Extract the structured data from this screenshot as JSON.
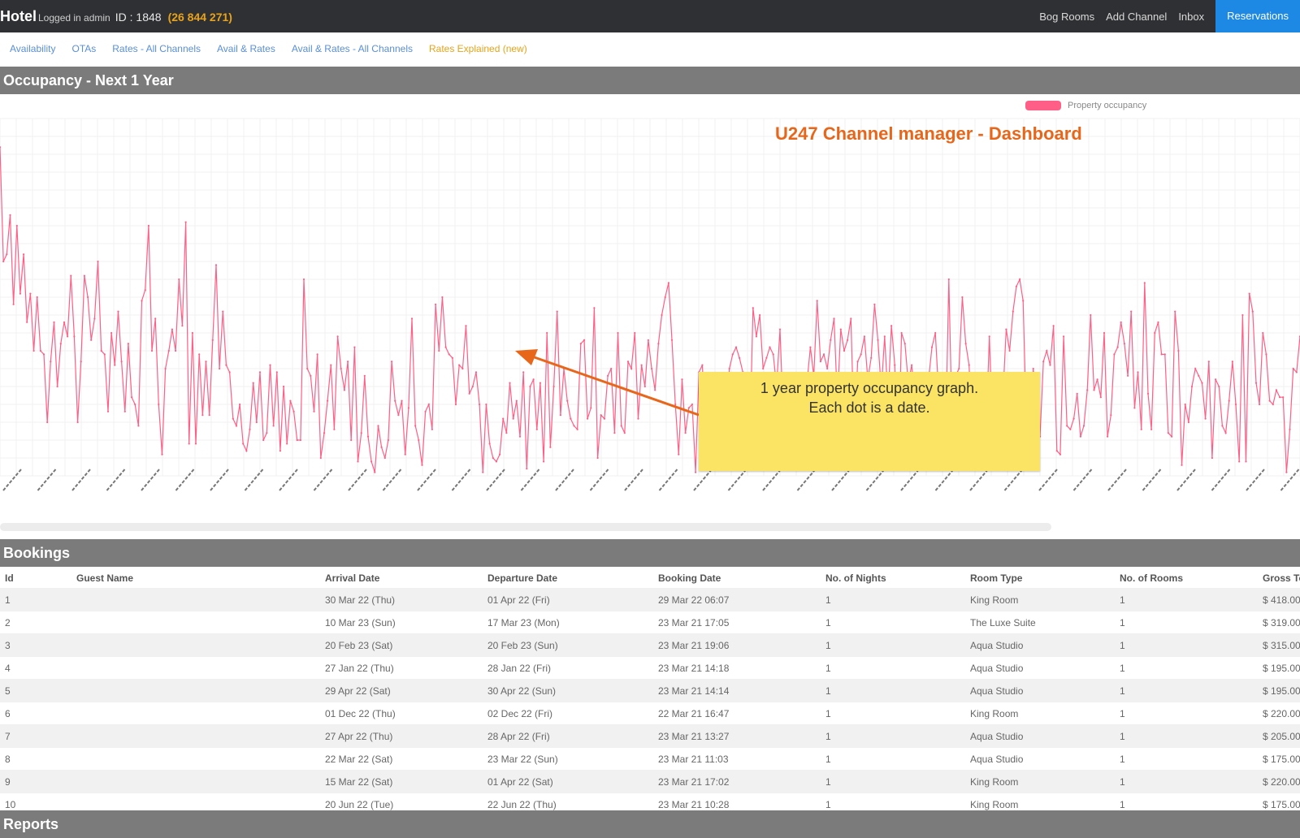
{
  "topbar": {
    "brand": "Hotel",
    "logged_in": "Logged in admin",
    "property_id": "ID : 1848",
    "phone": "(26 844 271)",
    "links": [
      "Bog Rooms",
      "Add Channel",
      "Inbox"
    ],
    "book_button": "Reservations"
  },
  "subnav": {
    "links": [
      "Availability",
      "OTAs",
      "Rates - All Channels",
      "Avail & Rates",
      "Avail & Rates - All Channels",
      "Rates Explained (new)"
    ]
  },
  "occupancy": {
    "header": "Occupancy - Next 1 Year",
    "legend": "Property occupancy",
    "overlay_title": "U247 Channel manager - Dashboard",
    "note_line1": "1 year property occupancy graph.",
    "note_line2": "Each dot is a date."
  },
  "colors": {
    "series": "#ff5f86",
    "annotation": "#e8661a",
    "note_bg": "#fbe463",
    "section_bg": "#7b7b7b",
    "topbar_bg": "#2f3033"
  },
  "chart_data": {
    "type": "line",
    "series": [
      {
        "name": "Property occupancy",
        "values": [
          92,
          60,
          62,
          73,
          48,
          70,
          51,
          62,
          43,
          51,
          35,
          50,
          35,
          34,
          15,
          32,
          43,
          25,
          37,
          43,
          39,
          56,
          39,
          15,
          32,
          56,
          50,
          38,
          44,
          60,
          35,
          34,
          18,
          40,
          31,
          46,
          32,
          18,
          37,
          22,
          20,
          14,
          49,
          52,
          70,
          35,
          44,
          20,
          6,
          30,
          35,
          41,
          35,
          55,
          42,
          71,
          9,
          40,
          9,
          34,
          17,
          32,
          17,
          38,
          59,
          30,
          46,
          31,
          29,
          16,
          14,
          20,
          9,
          7,
          13,
          26,
          15,
          29,
          10,
          12,
          31,
          14,
          29,
          7,
          25,
          9,
          21,
          18,
          10,
          10,
          55,
          30,
          28,
          18,
          34,
          5,
          12,
          21,
          31,
          13,
          39,
          30,
          24,
          32,
          10,
          36,
          4,
          12,
          28,
          11,
          4,
          1,
          14,
          8,
          5,
          10,
          32,
          21,
          17,
          21,
          6,
          19,
          44,
          14,
          10,
          3,
          18,
          20,
          13,
          48,
          35,
          50,
          36,
          34,
          33,
          20,
          31,
          30,
          42,
          23,
          25,
          29,
          20,
          1,
          20,
          9,
          5,
          4,
          6,
          16,
          12,
          26,
          16,
          21,
          11,
          29,
          2,
          25,
          27,
          13,
          26,
          4,
          40,
          8,
          25,
          46,
          17,
          30,
          21,
          16,
          14,
          13,
          37,
          38,
          16,
          19,
          47,
          5,
          17,
          16,
          28,
          30,
          12,
          40,
          14,
          12,
          32,
          30,
          40,
          16,
          31,
          25,
          38,
          30,
          24,
          37,
          45,
          50,
          54,
          38,
          20,
          6,
          27,
          12,
          19,
          20,
          1,
          29,
          31,
          13,
          19,
          21,
          12,
          5,
          3,
          11,
          30,
          34,
          36,
          33,
          29,
          16,
          7,
          47,
          39,
          45,
          30,
          33,
          36,
          34,
          25,
          41,
          15,
          14,
          12,
          23,
          19,
          23,
          10,
          26,
          36,
          28,
          49,
          32,
          34,
          30,
          38,
          44,
          21,
          41,
          35,
          38,
          44,
          10,
          32,
          34,
          39,
          27,
          33,
          48,
          38,
          24,
          39,
          21,
          42,
          31,
          4,
          40,
          37,
          26,
          31,
          21,
          17,
          8,
          16,
          27,
          36,
          40,
          23,
          23,
          8,
          55,
          13,
          28,
          30,
          50,
          37,
          31,
          10,
          11,
          21,
          27,
          12,
          39,
          10,
          7,
          21,
          22,
          41,
          35,
          46,
          53,
          55,
          49,
          13,
          15,
          30,
          18,
          11,
          32,
          35,
          31,
          42,
          7,
          6,
          39,
          14,
          13,
          16,
          23,
          11,
          14,
          24,
          45,
          24,
          27,
          22,
          40,
          11,
          17,
          34,
          36,
          43,
          37,
          28,
          46,
          19,
          29,
          13,
          54,
          23,
          13,
          40,
          43,
          34,
          34,
          12,
          11,
          46,
          35,
          3,
          20,
          15,
          25,
          30,
          28,
          26,
          16,
          32,
          5,
          27,
          25,
          14,
          12,
          21,
          32,
          20,
          4,
          45,
          4,
          51,
          46,
          26,
          20,
          40,
          34,
          21,
          20,
          24,
          22,
          22,
          1,
          13,
          30,
          29,
          39
        ]
      }
    ],
    "ylim": [
      0,
      100
    ],
    "grid": true,
    "legend_position": "top-right"
  },
  "bookings": {
    "header": "Bookings",
    "columns": [
      "Id",
      "Guest Name",
      "Arrival Date",
      "Departure Date",
      "Booking Date",
      "No. of Nights",
      "Room Type",
      "No. of Rooms",
      "Gross Total"
    ],
    "rows": [
      [
        "1",
        "",
        "30 Mar 22 (Thu)",
        "01 Apr 22 (Fri)",
        "29 Mar 22 06:07",
        "1",
        "King Room",
        "1",
        "$ 418.00"
      ],
      [
        "2",
        "",
        "10 Mar 23 (Sun)",
        "17 Mar 23 (Mon)",
        "23 Mar 21 17:05",
        "1",
        "The Luxe Suite",
        "1",
        "$ 319.00"
      ],
      [
        "3",
        "",
        "20 Feb 23 (Sat)",
        "20 Feb 23 (Sun)",
        "23 Mar 21 19:06",
        "1",
        "Aqua Studio",
        "1",
        "$ 315.00"
      ],
      [
        "4",
        "",
        "27 Jan 22 (Thu)",
        "28 Jan 22 (Fri)",
        "23 Mar 21 14:18",
        "1",
        "Aqua Studio",
        "1",
        "$ 195.00"
      ],
      [
        "5",
        "",
        "29 Apr 22 (Sat)",
        "30 Apr 22 (Sun)",
        "23 Mar 21 14:14",
        "1",
        "Aqua Studio",
        "1",
        "$ 195.00"
      ],
      [
        "6",
        "",
        "01 Dec 22 (Thu)",
        "02 Dec 22 (Fri)",
        "22 Mar 21 16:47",
        "1",
        "King Room",
        "1",
        "$ 220.00"
      ],
      [
        "7",
        "",
        "27 Apr 22 (Thu)",
        "28 Apr 22 (Fri)",
        "23 Mar 21 13:27",
        "1",
        "Aqua Studio",
        "1",
        "$ 205.00"
      ],
      [
        "8",
        "",
        "22 Mar 22 (Sat)",
        "23 Mar 22 (Sun)",
        "23 Mar 21 11:03",
        "1",
        "Aqua Studio",
        "1",
        "$ 175.00"
      ],
      [
        "9",
        "",
        "15 Mar 22 (Sat)",
        "01 Apr 22 (Sat)",
        "23 Mar 21 17:02",
        "1",
        "King Room",
        "1",
        "$ 220.00"
      ],
      [
        "10",
        "",
        "20 Jun 22 (Tue)",
        "22 Jun 22 (Thu)",
        "23 Mar 21 10:28",
        "1",
        "King Room",
        "1",
        "$ 175.00"
      ]
    ]
  },
  "reports": {
    "header": "Reports"
  }
}
